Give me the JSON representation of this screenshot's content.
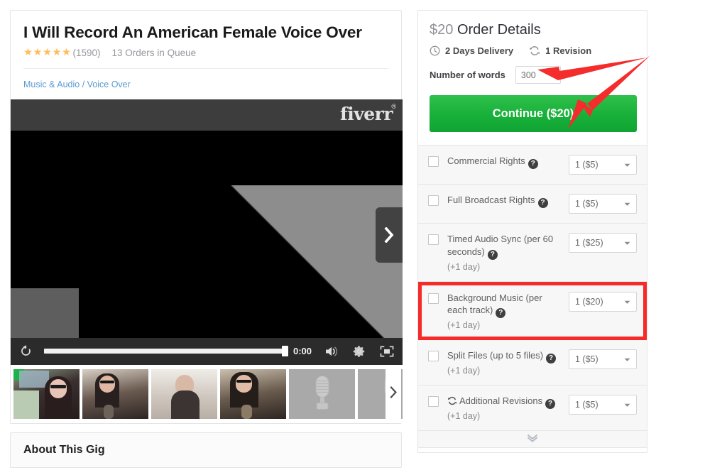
{
  "gig": {
    "title": "I Will Record An American Female Voice Over",
    "stars": "★★★★★",
    "rating_count": "(1590)",
    "orders_in_queue": "13 Orders in Queue",
    "breadcrumb_category": "Music & Audio",
    "breadcrumb_separator": "/",
    "breadcrumb_subcategory": "Voice Over",
    "about_title": "About This Gig"
  },
  "video": {
    "brand": "fiverr",
    "brand_mark": "®",
    "time": "0:00",
    "replay_icon": "replay-icon",
    "volume_icon": "volume-icon",
    "settings_icon": "gear-icon",
    "fullscreen_icon": "fullscreen-icon",
    "next_icon": "chevron-right-icon",
    "thumbs_next_icon": "chevron-right-icon",
    "thumbnails": [
      {
        "name": "thumb-person-webcam",
        "kind": "person1"
      },
      {
        "name": "thumb-person-mic",
        "kind": "person2"
      },
      {
        "name": "thumb-person-portrait",
        "kind": "person3"
      },
      {
        "name": "thumb-person-mic-2",
        "kind": "person4"
      },
      {
        "name": "thumb-microphone-1",
        "kind": "mic"
      },
      {
        "name": "thumb-microphone-2",
        "kind": "mic"
      },
      {
        "name": "thumb-microphone-3",
        "kind": "mic"
      }
    ]
  },
  "order": {
    "price": "$20",
    "title": "Order Details",
    "delivery": "2 Days Delivery",
    "delivery_icon": "clock-icon",
    "revision": "1 Revision",
    "revision_icon": "refresh-icon",
    "words_label": "Number of words",
    "words_value": "300",
    "words_placeholder": "300",
    "continue_label": "Continue ($20)",
    "more_icon": "chevron-double-down-icon",
    "extras": [
      {
        "label": "Commercial Rights",
        "help": "?",
        "sub": "",
        "select": "1 ($5)",
        "highlighted": false,
        "has_revision_icon": false
      },
      {
        "label": "Full Broadcast Rights",
        "help": "?",
        "sub": "",
        "select": "1 ($5)",
        "highlighted": false,
        "has_revision_icon": false
      },
      {
        "label": "Timed Audio Sync (per 60 seconds)",
        "help": "?",
        "sub": "(+1 day)",
        "select": "1 ($25)",
        "highlighted": false,
        "has_revision_icon": false
      },
      {
        "label": "Background Music (per each track)",
        "help": "?",
        "sub": "(+1 day)",
        "select": "1 ($20)",
        "highlighted": true,
        "has_revision_icon": false
      },
      {
        "label": "Split Files (up to 5 files)",
        "help": "?",
        "sub": "(+1 day)",
        "select": "1 ($5)",
        "highlighted": false,
        "has_revision_icon": false
      },
      {
        "label": "Additional Revisions",
        "help": "?",
        "sub": "(+1 day)",
        "select": "1 ($5)",
        "highlighted": false,
        "has_revision_icon": true
      }
    ]
  },
  "annotations": {
    "arrow_color": "#f42c2c",
    "highlight_color": "#f72a2a",
    "arrows": [
      {
        "name": "arrow-to-words-input",
        "target": "number-of-words-input"
      },
      {
        "name": "arrow-to-continue-button",
        "target": "continue-button"
      }
    ],
    "highlight_box": {
      "name": "highlight-background-music-row",
      "target": "extra-row-background-music"
    }
  },
  "colors": {
    "accent_green": "#18b03a",
    "link_blue": "#5a9ad1",
    "star_gold": "#ffbe5b",
    "annotation_red": "#f42c2c"
  }
}
